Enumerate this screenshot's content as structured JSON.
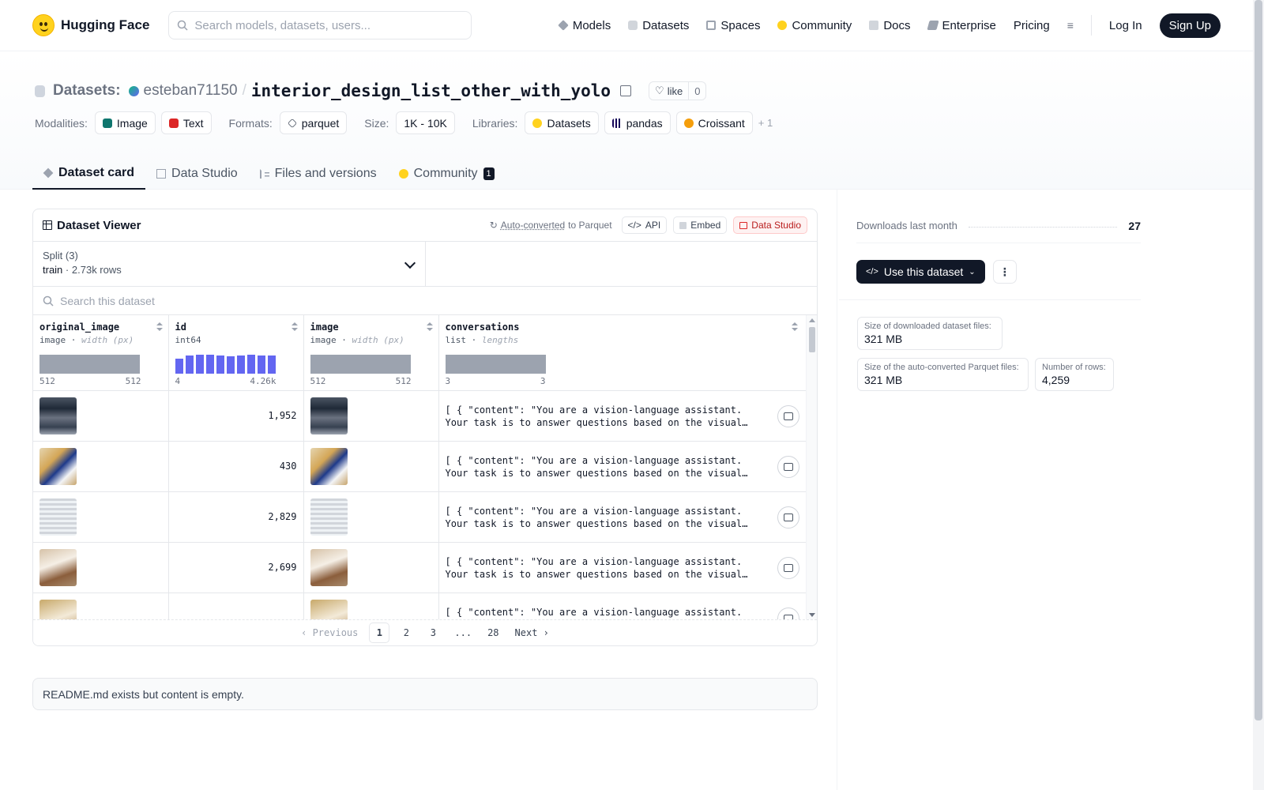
{
  "nav": {
    "brand": "Hugging Face",
    "search_placeholder": "Search models, datasets, users...",
    "links": [
      "Models",
      "Datasets",
      "Spaces",
      "Community",
      "Docs",
      "Enterprise",
      "Pricing"
    ],
    "login": "Log In",
    "signup": "Sign Up"
  },
  "repo": {
    "section_label": "Datasets:",
    "owner": "esteban71150",
    "separator": "/",
    "name": "interior_design_list_other_with_yolo",
    "like_label": "like",
    "like_count": "0"
  },
  "tags": {
    "modalities_label": "Modalities:",
    "modalities": [
      "Image",
      "Text"
    ],
    "formats_label": "Formats:",
    "formats": [
      "parquet"
    ],
    "size_label": "Size:",
    "size": "1K - 10K",
    "libraries_label": "Libraries:",
    "libraries": [
      "Datasets",
      "pandas",
      "Croissant"
    ],
    "more": "+ 1"
  },
  "tabs": [
    "Dataset card",
    "Data Studio",
    "Files and versions",
    "Community"
  ],
  "community_count": "1",
  "viewer": {
    "title": "Dataset Viewer",
    "auto_converted": "Auto-converted",
    "to_parquet": "to Parquet",
    "api": "API",
    "embed": "Embed",
    "data_studio": "Data Studio",
    "split_label": "Split (3)",
    "split_name": "train",
    "split_dot": "·",
    "split_rows": "2.73k rows",
    "search_placeholder": "Search this dataset",
    "columns": [
      {
        "name": "original_image",
        "type": "image",
        "sub": "width (px)",
        "min": "512",
        "max": "512"
      },
      {
        "name": "id",
        "type": "int64",
        "sub": "",
        "min": "4",
        "max": "4.26k"
      },
      {
        "name": "image",
        "type": "image",
        "sub": "width (px)",
        "min": "512",
        "max": "512"
      },
      {
        "name": "conversations",
        "type": "list",
        "sub": "lengths",
        "min": "3",
        "max": "3"
      }
    ],
    "id_histogram": [
      0.8,
      0.95,
      1.0,
      1.0,
      0.95,
      0.9,
      0.95,
      1.0,
      0.95,
      0.95
    ],
    "type_separator": " · ",
    "rows": [
      {
        "id": "1,952",
        "conv": "[ { \"content\": \"You are a vision-language assistant. Your task is to answer questions based on the visual context…"
      },
      {
        "id": "430",
        "conv": "[ { \"content\": \"You are a vision-language assistant. Your task is to answer questions based on the visual context…"
      },
      {
        "id": "2,829",
        "conv": "[ { \"content\": \"You are a vision-language assistant. Your task is to answer questions based on the visual context…"
      },
      {
        "id": "2,699",
        "conv": "[ { \"content\": \"You are a vision-language assistant. Your task is to answer questions based on the visual context…"
      },
      {
        "id": "",
        "conv": "[ { \"content\": \"You are a vision-language assistant. Your task is to answer questions based on the visual context…"
      }
    ],
    "pager": {
      "prev": "Previous",
      "pages": [
        "1",
        "2",
        "3",
        "...",
        "28"
      ],
      "next": "Next"
    }
  },
  "readme": "README.md exists but content is empty.",
  "sidebar": {
    "downloads_label": "Downloads last month",
    "downloads": "27",
    "use_button": "Use this dataset",
    "stats": [
      {
        "label": "Size of downloaded dataset files:",
        "value": "321 MB"
      },
      {
        "label": "Size of the auto-converted Parquet files:",
        "value": "321 MB"
      },
      {
        "label": "Number of rows:",
        "value": "4,259"
      }
    ]
  },
  "colors": {
    "brand_yellow": "#ffd21e",
    "dark": "#111827",
    "histogram_blue": "#6366f1",
    "histogram_gray": "#9ca3af"
  },
  "icons": [
    "search-icon",
    "models-icon",
    "datasets-icon",
    "spaces-icon",
    "community-icon",
    "docs-icon",
    "enterprise-icon",
    "menu-icon",
    "copy-icon",
    "heart-icon",
    "grid-icon",
    "refresh-icon",
    "code-icon",
    "chat-icon",
    "chevron-down-icon",
    "kebab-icon"
  ]
}
